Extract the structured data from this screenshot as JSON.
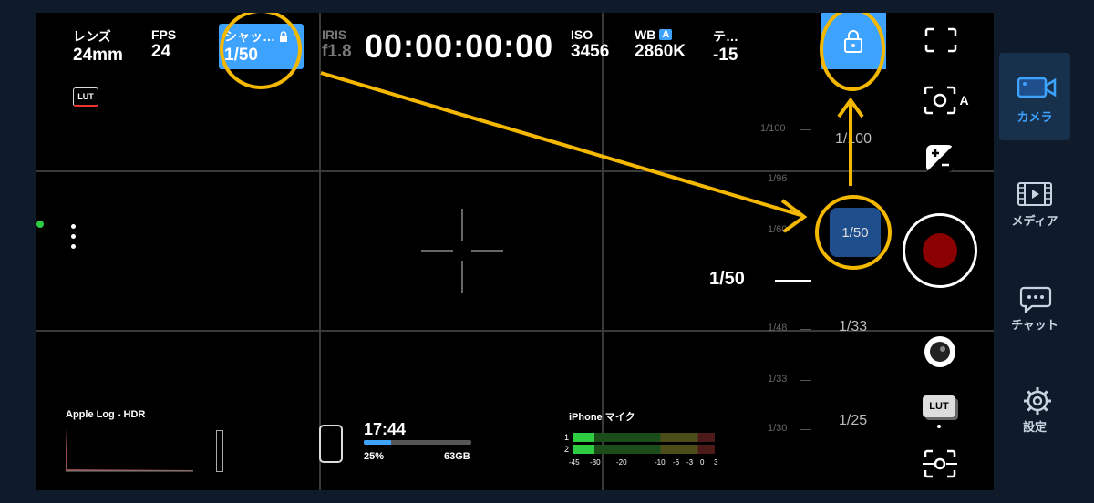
{
  "topbar": {
    "lens": {
      "label": "レンズ",
      "value": "24mm"
    },
    "fps": {
      "label": "FPS",
      "value": "24"
    },
    "shutter": {
      "label": "シャッ…",
      "value": "1/50"
    },
    "iris": {
      "label": "IRIS",
      "value": "f1.8"
    },
    "timecode": "00:00:00:00",
    "iso": {
      "label": "ISO",
      "value": "3456"
    },
    "wb": {
      "label": "WB",
      "badge": "A",
      "value": "2860K"
    },
    "tint": {
      "label": "テ…",
      "value": "-15"
    },
    "lut_badge": "LUT"
  },
  "shutter_scale": {
    "small_ticks": [
      "1/100",
      "1/96",
      "1/60",
      "1/48",
      "1/33",
      "1/30"
    ],
    "big_ticks": [
      "1/100",
      "1/50",
      "1/33",
      "1/25"
    ],
    "current_label": "1/50"
  },
  "bottom": {
    "histogram_label": "Apple Log - HDR",
    "storage_time": "17:44",
    "storage_percent": "25%",
    "storage_percent_value": 25,
    "storage_size": "63GB",
    "mic_label": "iPhone マイク",
    "channel_1": "1",
    "channel_2": "2",
    "meter_scale": [
      "-45",
      "-30",
      "-20",
      "-10",
      "-6",
      "-3",
      "0",
      "3"
    ],
    "meter_level": 0.04
  },
  "right_controls": {
    "lut_label": "LUT",
    "af_label": "A"
  },
  "sidebar": {
    "items": [
      {
        "label": "カメラ",
        "icon": "camera-icon",
        "active": true
      },
      {
        "label": "メディア",
        "icon": "film-icon",
        "active": false
      },
      {
        "label": "チャット",
        "icon": "chat-icon",
        "active": false
      },
      {
        "label": "設定",
        "icon": "gear-icon",
        "active": false
      }
    ]
  },
  "colors": {
    "accent": "#3ea2ff",
    "annotation": "#f5b800",
    "record": "#8b0000",
    "sidebar_bg": "#0f1b2a"
  }
}
